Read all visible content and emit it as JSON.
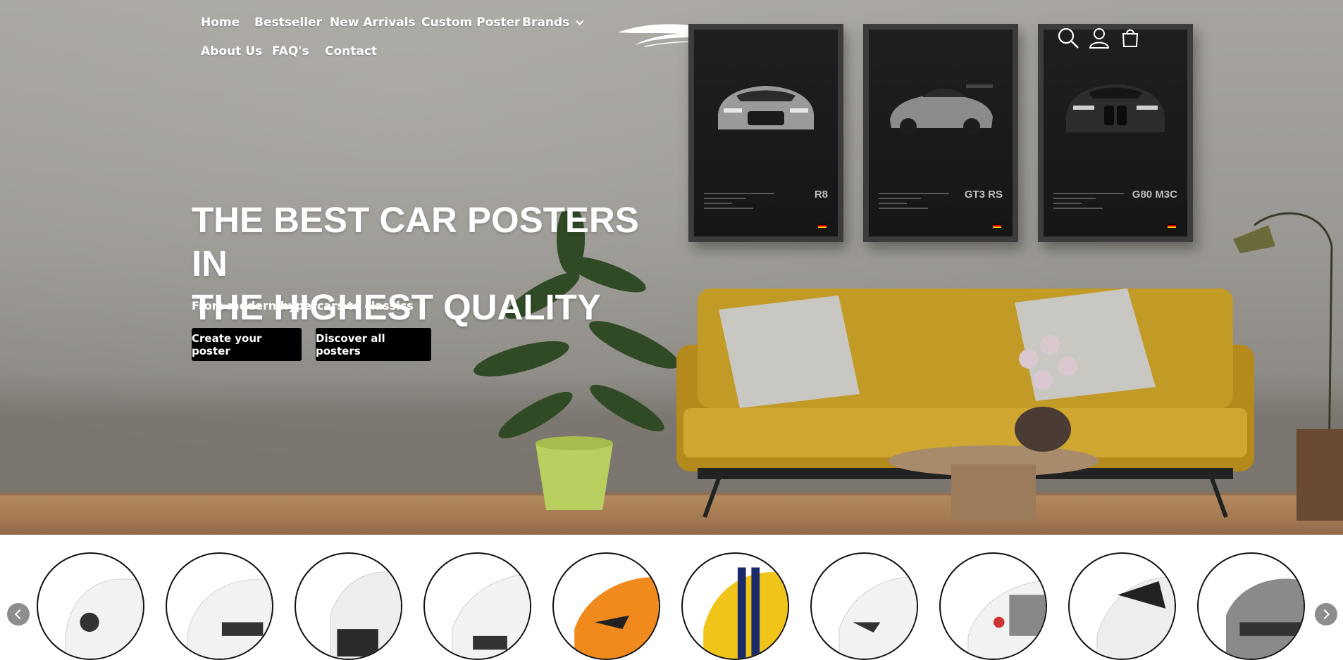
{
  "nav": {
    "items": [
      {
        "label": "Home"
      },
      {
        "label": "Bestseller"
      },
      {
        "label": "New Arrivals"
      },
      {
        "label": "Custom Poster"
      },
      {
        "label": "Brands"
      },
      {
        "label": "About Us"
      },
      {
        "label": "FAQ's"
      },
      {
        "label": "Contact"
      }
    ]
  },
  "header_icons": [
    "search-icon",
    "account-icon",
    "cart-icon"
  ],
  "hero": {
    "title_line1": "THE BEST CAR POSTERS IN",
    "title_line2": "THE HIGHEST QUALITY",
    "subtitle": "From modern hypercars to classics",
    "buttons": {
      "create": "Create your poster",
      "discover": "Discover all posters"
    }
  },
  "posters": [
    {
      "model": "R8"
    },
    {
      "model": "GT3 RS"
    },
    {
      "model": "G80 M3C"
    }
  ],
  "carousel": {
    "count": 10,
    "car_colors": [
      "#f2f2f2",
      "#f2f2f2",
      "#eeeeee",
      "#f2f2f2",
      "#f08a1c",
      "#f0c419",
      "#f2f2f2",
      "#f2f2f2",
      "#eeeeee",
      "#8a8a8a"
    ],
    "prev_icon": "chevron-left-icon",
    "next_icon": "chevron-right-icon"
  },
  "colors": {
    "button_bg": "#000000",
    "text_on_hero": "#ffffff"
  }
}
